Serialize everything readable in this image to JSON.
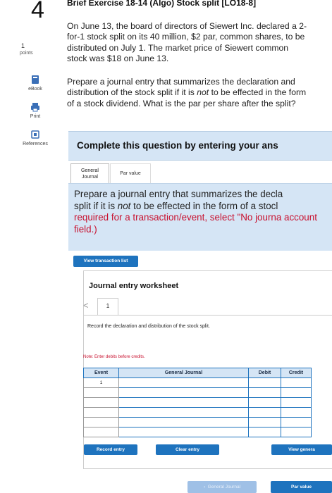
{
  "question": {
    "number": "4",
    "title": "Brief Exercise 18-14 (Algo) Stock split [LO18-8]",
    "points_value": "1",
    "points_label": "points",
    "paragraph1": "On June 13, the board of directors of Siewert Inc. declared a 2-for-1 stock split on its 40 million, $2 par, common shares, to be distributed on July 1. The market price of Siewert common stock was $18 on June 13.",
    "paragraph2_a": "Prepare a journal entry that summarizes the declaration and distribution of the stock split if it is ",
    "paragraph2_em": "not",
    "paragraph2_b": " to be effected in the form of a stock dividend. What is the par per share after the split?"
  },
  "sidebar": {
    "ebook": "eBook",
    "print": "Print",
    "references": "References"
  },
  "complete_banner": "Complete this question by entering your ans",
  "tabs": {
    "general_journal_1": "General",
    "general_journal_2": "Journal",
    "par_value": "Par value"
  },
  "instructions": {
    "text_a": "Prepare a journal entry that summarizes the decla",
    "text_b": "split if it is ",
    "text_em": "not",
    "text_c": " to be effected in the form of a stocl",
    "text_red": "required for a transaction/event, select \"No journa account field.)"
  },
  "buttons": {
    "view_transaction_list": "View transaction list",
    "record_entry": "Record entry",
    "clear_entry": "Clear entry",
    "view_general_journal": "View genera",
    "nav_general_journal": "General Journal",
    "nav_par_value": "Par value"
  },
  "worksheet": {
    "title": "Journal entry worksheet",
    "prev_arrow": "<",
    "page": "1",
    "description": "Record the declaration and distribution of the stock split.",
    "note": "Note: Enter debits before credits.",
    "columns": {
      "event": "Event",
      "general_journal": "General Journal",
      "debit": "Debit",
      "credit": "Credit"
    },
    "event_value": "1"
  },
  "colors": {
    "accent": "#1e73be",
    "panel": "#d5e5f5",
    "note_red": "#c8102e"
  }
}
